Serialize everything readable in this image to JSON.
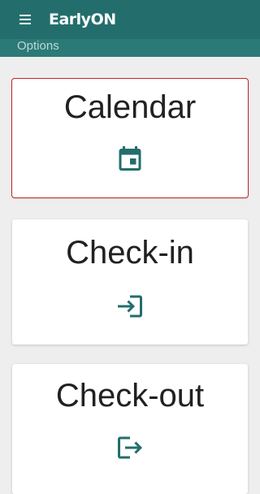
{
  "app_bar": {
    "title": "EarlyON",
    "menu_icon": "hamburger-menu-icon",
    "background_color": "#236e6c"
  },
  "subheader": {
    "label": "Options"
  },
  "options": [
    {
      "label": "Calendar",
      "icon": "calendar-icon",
      "selected": true
    },
    {
      "label": "Check-in",
      "icon": "login-icon",
      "selected": false
    },
    {
      "label": "Check-out",
      "icon": "logout-icon",
      "selected": false
    }
  ],
  "colors": {
    "accent": "#236e6c",
    "selection_outline": "#c9242b"
  }
}
